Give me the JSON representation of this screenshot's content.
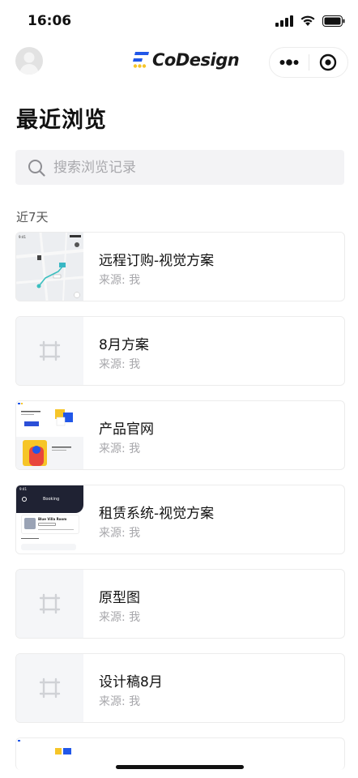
{
  "status_bar": {
    "time": "16:06"
  },
  "nav": {
    "logo_text": "CoDesign",
    "brand_colors": {
      "blue": "#2157e8",
      "yellow": "#f6c528"
    }
  },
  "page": {
    "title": "最近浏览"
  },
  "search": {
    "placeholder": "搜索浏览记录"
  },
  "section": {
    "label": "近7天"
  },
  "items": [
    {
      "title": "远程订购-视觉方案",
      "source": "来源: 我",
      "thumbnail": "map-screen-preview"
    },
    {
      "title": "8月方案",
      "source": "来源: 我",
      "thumbnail": "frame-placeholder-icon"
    },
    {
      "title": "产品官网",
      "source": "来源: 我",
      "thumbnail": "website-preview"
    },
    {
      "title": "租赁系统-视觉方案",
      "source": "来源: 我",
      "thumbnail": "booking-app-preview"
    },
    {
      "title": "原型图",
      "source": "来源: 我",
      "thumbnail": "frame-placeholder-icon"
    },
    {
      "title": "设计稿8月",
      "source": "来源: 我",
      "thumbnail": "frame-placeholder-icon"
    }
  ],
  "booking_preview": {
    "time": "9:41",
    "header": "Booking",
    "card_title": "Blue Villa Room"
  }
}
